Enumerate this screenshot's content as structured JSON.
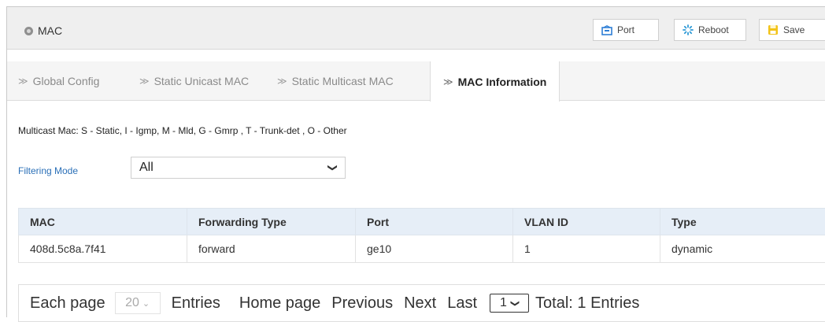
{
  "header": {
    "title": "MAC",
    "buttons": {
      "port": "Port",
      "reboot": "Reboot",
      "save": "Save"
    }
  },
  "tabs": [
    {
      "label": "Global Config",
      "active": false
    },
    {
      "label": "Static Unicast MAC",
      "active": false
    },
    {
      "label": "Static Multicast MAC",
      "active": false
    },
    {
      "label": "MAC Information",
      "active": true
    }
  ],
  "legend": "Multicast Mac: S - Static, I - Igmp, M - Mld, G - Gmrp , T - Trunk-det , O - Other",
  "filter": {
    "label": "Filtering Mode",
    "value": "All"
  },
  "table": {
    "headers": [
      "MAC",
      "Forwarding Type",
      "Port",
      "VLAN ID",
      "Type"
    ],
    "rows": [
      [
        "408d.5c8a.7f41",
        "forward",
        "ge10",
        "1",
        "dynamic"
      ]
    ]
  },
  "pager": {
    "each_page": "Each page",
    "per_page_value": "20",
    "entries": "Entries",
    "home": "Home page",
    "previous": "Previous",
    "next": "Next",
    "last": "Last",
    "page_value": "1",
    "total": "Total: 1 Entries"
  },
  "colors": {
    "header_bg": "#efefef",
    "table_header_bg": "#e6eef7",
    "filter_label": "#2a6fb7",
    "port_icon": "#2f7fd6",
    "reboot_icon": "#2f9ad6",
    "save_icon": "#f2c318"
  },
  "icons": {
    "title": "status-dot-icon",
    "port": "port-icon",
    "reboot": "reboot-icon",
    "save": "save-icon",
    "tab": "chevron-right-icon"
  }
}
